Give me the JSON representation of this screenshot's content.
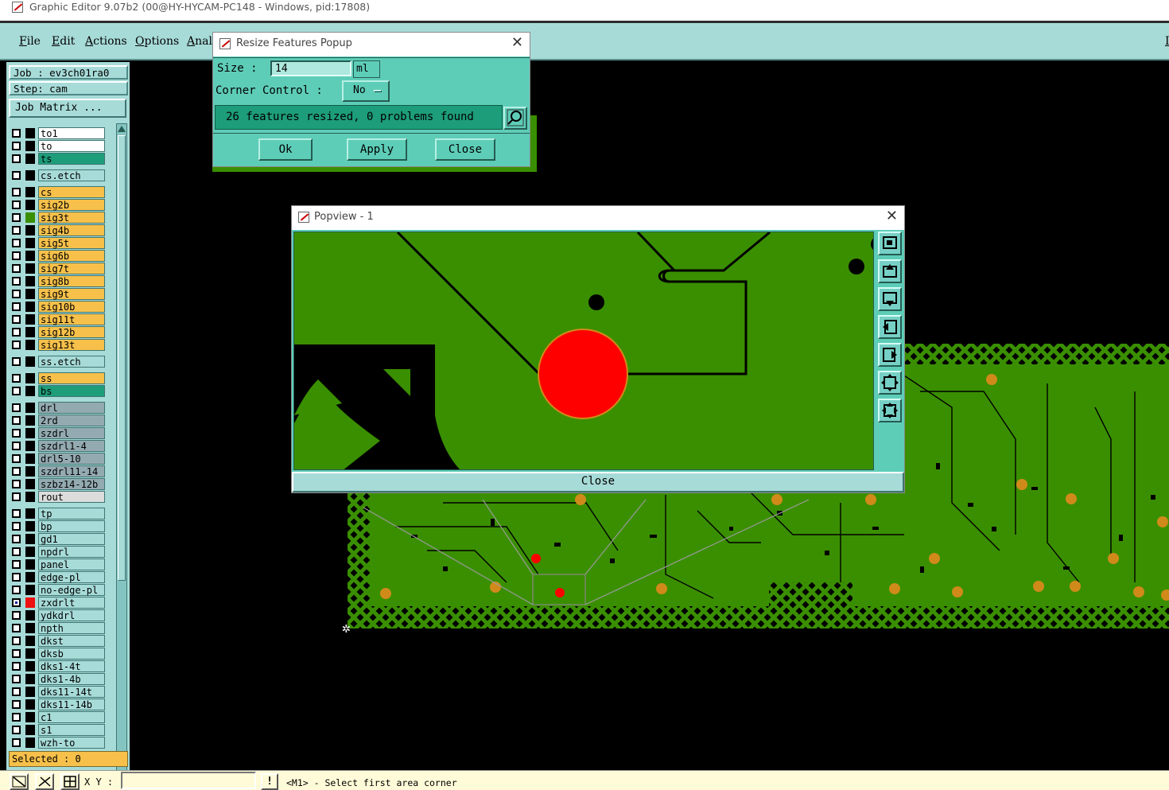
{
  "titlebar": {
    "title": "Graphic Editor 9.07b2 (00@HY-HYCAM-PC148 - Windows, pid:17808)"
  },
  "menu": {
    "file": "File",
    "edit": "Edit",
    "actions": "Actions",
    "options": "Options",
    "analysis": "Analy",
    "right": "I"
  },
  "job": {
    "job": "Job : ev3ch01ra0",
    "step": "Step: cam",
    "matrix_button": "Job Matrix ..."
  },
  "layers": [
    {
      "name": "to1",
      "bg": "#ffffff",
      "mark": "#000000",
      "checked": false
    },
    {
      "name": "to",
      "bg": "#ffffff",
      "mark": "#000000",
      "checked": false
    },
    {
      "name": "ts",
      "bg": "#1d9d7a",
      "mark": "#000000",
      "checked": false
    },
    {
      "name": "cs.etch",
      "bg": "#a7dbd8",
      "mark": "#000000",
      "checked": false,
      "gap": true
    },
    {
      "name": "cs",
      "bg": "#f6c04a",
      "mark": "#000000",
      "checked": false,
      "gap": true
    },
    {
      "name": "sig2b",
      "bg": "#f6c04a",
      "mark": "#000000",
      "checked": false
    },
    {
      "name": "sig3t",
      "bg": "#f6c04a",
      "mark": "#3a8f00",
      "checked": false
    },
    {
      "name": "sig4b",
      "bg": "#f6c04a",
      "mark": "#000000",
      "checked": false
    },
    {
      "name": "sig5t",
      "bg": "#f6c04a",
      "mark": "#000000",
      "checked": false
    },
    {
      "name": "sig6b",
      "bg": "#f6c04a",
      "mark": "#000000",
      "checked": false
    },
    {
      "name": "sig7t",
      "bg": "#f6c04a",
      "mark": "#000000",
      "checked": false
    },
    {
      "name": "sig8b",
      "bg": "#f6c04a",
      "mark": "#000000",
      "checked": false
    },
    {
      "name": "sig9t",
      "bg": "#f6c04a",
      "mark": "#000000",
      "checked": false
    },
    {
      "name": "sig10b",
      "bg": "#f6c04a",
      "mark": "#000000",
      "checked": false
    },
    {
      "name": "sig11t",
      "bg": "#f6c04a",
      "mark": "#000000",
      "checked": false
    },
    {
      "name": "sig12b",
      "bg": "#f6c04a",
      "mark": "#000000",
      "checked": false
    },
    {
      "name": "sig13t",
      "bg": "#f6c04a",
      "mark": "#000000",
      "checked": false
    },
    {
      "name": "ss.etch",
      "bg": "#a7dbd8",
      "mark": "#000000",
      "checked": false,
      "gap": true
    },
    {
      "name": "ss",
      "bg": "#f6c04a",
      "mark": "#000000",
      "checked": false,
      "gap": true
    },
    {
      "name": "bs",
      "bg": "#1d9d7a",
      "mark": "#000000",
      "checked": false
    },
    {
      "name": "drl",
      "bg": "#94aab1",
      "mark": "#000000",
      "checked": false,
      "gap": true
    },
    {
      "name": "2rd",
      "bg": "#94aab1",
      "mark": "#000000",
      "checked": false
    },
    {
      "name": "szdrl",
      "bg": "#94aab1",
      "mark": "#000000",
      "checked": false
    },
    {
      "name": "szdrl1-4",
      "bg": "#94aab1",
      "mark": "#000000",
      "checked": false
    },
    {
      "name": "drl5-10",
      "bg": "#94aab1",
      "mark": "#000000",
      "checked": false
    },
    {
      "name": "szdrl11-14",
      "bg": "#94aab1",
      "mark": "#000000",
      "checked": false
    },
    {
      "name": "szbz14-12b",
      "bg": "#94aab1",
      "mark": "#000000",
      "checked": false
    },
    {
      "name": "rout",
      "bg": "#dcdcdc",
      "mark": "#000000",
      "checked": false
    },
    {
      "name": "tp",
      "bg": "#a7dbd8",
      "mark": "#000000",
      "checked": false,
      "gap": true
    },
    {
      "name": "bp",
      "bg": "#a7dbd8",
      "mark": "#000000",
      "checked": false
    },
    {
      "name": "gd1",
      "bg": "#a7dbd8",
      "mark": "#000000",
      "checked": false
    },
    {
      "name": "npdrl",
      "bg": "#a7dbd8",
      "mark": "#000000",
      "checked": false
    },
    {
      "name": "panel",
      "bg": "#a7dbd8",
      "mark": "#000000",
      "checked": false
    },
    {
      "name": "edge-pl",
      "bg": "#a7dbd8",
      "mark": "#000000",
      "checked": false
    },
    {
      "name": "no-edge-pl",
      "bg": "#a7dbd8",
      "mark": "#000000",
      "checked": false
    },
    {
      "name": "zxdrlt",
      "bg": "#a7dbd8",
      "mark": "#ee1111",
      "checked": true
    },
    {
      "name": "ydkdrl",
      "bg": "#a7dbd8",
      "mark": "#000000",
      "checked": false
    },
    {
      "name": "npth",
      "bg": "#a7dbd8",
      "mark": "#000000",
      "checked": false
    },
    {
      "name": "dkst",
      "bg": "#a7dbd8",
      "mark": "#000000",
      "checked": false
    },
    {
      "name": "dksb",
      "bg": "#a7dbd8",
      "mark": "#000000",
      "checked": false
    },
    {
      "name": "dks1-4t",
      "bg": "#a7dbd8",
      "mark": "#000000",
      "checked": false
    },
    {
      "name": "dks1-4b",
      "bg": "#a7dbd8",
      "mark": "#000000",
      "checked": false
    },
    {
      "name": "dks11-14t",
      "bg": "#a7dbd8",
      "mark": "#000000",
      "checked": false
    },
    {
      "name": "dks11-14b",
      "bg": "#a7dbd8",
      "mark": "#000000",
      "checked": false
    },
    {
      "name": "c1",
      "bg": "#a7dbd8",
      "mark": "#000000",
      "checked": false
    },
    {
      "name": "s1",
      "bg": "#a7dbd8",
      "mark": "#000000",
      "checked": false
    },
    {
      "name": "wzh-to",
      "bg": "#a7dbd8",
      "mark": "#000000",
      "checked": false
    }
  ],
  "selected": {
    "label": "Selected : 0"
  },
  "resize_popup": {
    "title": "Resize Features Popup",
    "size_label": "Size :",
    "size_value": "14",
    "size_unit": "ml",
    "corner_label": "Corner Control :",
    "corner_value": "No",
    "message": "26 features resized, 0 problems found",
    "ok": "Ok",
    "apply": "Apply",
    "close": "Close"
  },
  "popview": {
    "title": "Popview - 1",
    "close_button": "Close",
    "tools": [
      "zoom-window-icon",
      "pan-up-icon",
      "pan-down-icon",
      "pan-left-icon",
      "pan-right-icon",
      "zoom-out-icon",
      "zoom-fit-icon"
    ]
  },
  "status": {
    "xy_label": "X Y :",
    "xy_value": "",
    "message": "<M1> - Select first area corner"
  },
  "colors": {
    "accent": "#5ecdb8",
    "panel": "#a7dbd8",
    "copper": "#3a8f00",
    "pad": "#ff0000",
    "signal_layer": "#f6c04a"
  }
}
